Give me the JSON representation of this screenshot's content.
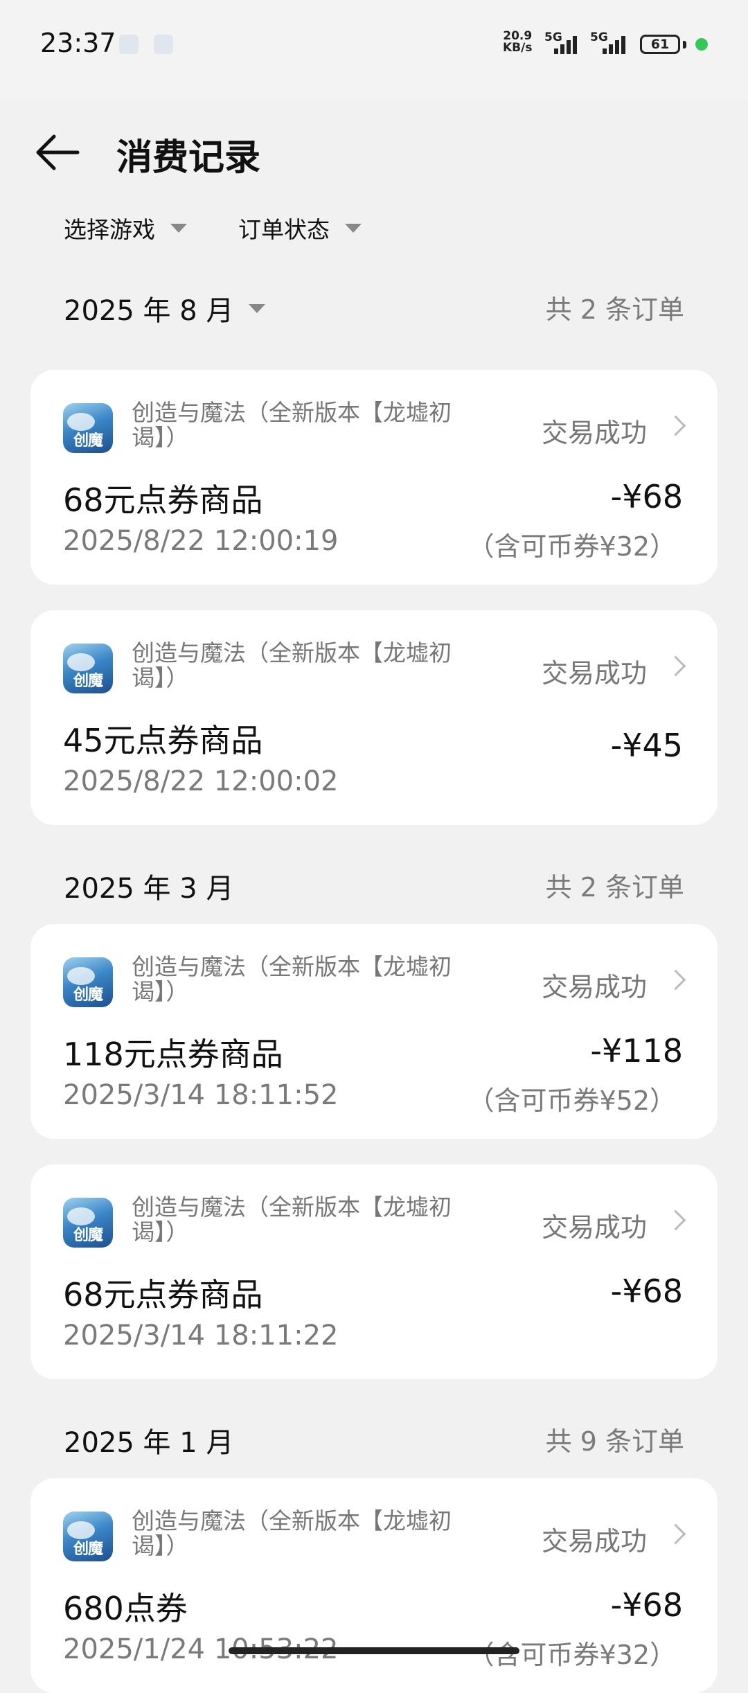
{
  "status_bar": {
    "time": "23:37",
    "net_speed_value": "20.9",
    "net_speed_unit": "KB/s",
    "network_1": "5G",
    "network_2": "5G",
    "battery": "61",
    "dot_color": "#34c759"
  },
  "header": {
    "title": "消费记录",
    "back_icon": "arrow-left-icon"
  },
  "filters": {
    "game": "选择游戏",
    "status": "订单状态"
  },
  "months": [
    {
      "label": "2025 年 8 月",
      "count": "共 2 条订单",
      "orders": [
        {
          "game": "创造与魔法（全新版本【龙墟初谒】）",
          "icon_text": "创魔",
          "status": "交易成功",
          "product": "68元点券商品",
          "amount": "-¥68",
          "time": "2025/8/22 12:00:19",
          "note": "（含可币券¥32）"
        },
        {
          "game": "创造与魔法（全新版本【龙墟初谒】）",
          "icon_text": "创魔",
          "status": "交易成功",
          "product": "45元点券商品",
          "amount": "-¥45",
          "time": "2025/8/22 12:00:02",
          "note": ""
        }
      ]
    },
    {
      "label": "2025 年 3 月",
      "count": "共 2 条订单",
      "orders": [
        {
          "game": "创造与魔法（全新版本【龙墟初谒】）",
          "icon_text": "创魔",
          "status": "交易成功",
          "product": "118元点券商品",
          "amount": "-¥118",
          "time": "2025/3/14 18:11:52",
          "note": "（含可币券¥52）"
        },
        {
          "game": "创造与魔法（全新版本【龙墟初谒】）",
          "icon_text": "创魔",
          "status": "交易成功",
          "product": "68元点券商品",
          "amount": "-¥68",
          "time": "2025/3/14 18:11:22",
          "note": ""
        }
      ]
    },
    {
      "label": "2025 年 1 月",
      "count": "共 9 条订单",
      "orders": [
        {
          "game": "创造与魔法（全新版本【龙墟初谒】）",
          "icon_text": "创魔",
          "status": "交易成功",
          "product": "680点券",
          "amount": "-¥68",
          "time": "2025/1/24 10:53:22",
          "note": "（含可币券¥32）"
        }
      ]
    }
  ]
}
